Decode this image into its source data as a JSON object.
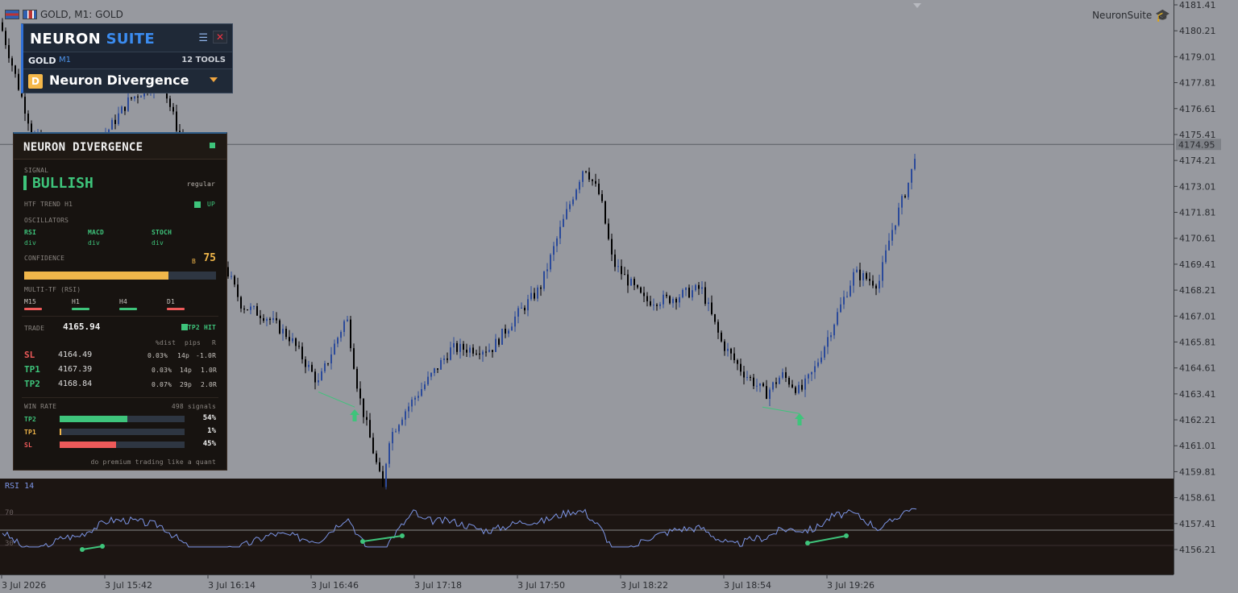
{
  "window": {
    "title": "GOLD, M1:  GOLD",
    "brand": "NeuronSuite"
  },
  "axis": {
    "price_labels": [
      "4181.41",
      "4180.21",
      "4179.01",
      "4177.81",
      "4176.61",
      "4175.41",
      "4174.21",
      "4173.01",
      "4171.81",
      "4170.61",
      "4169.41",
      "4168.21",
      "4167.01",
      "4165.81",
      "4164.61",
      "4163.41",
      "4162.21",
      "4161.01",
      "4159.81",
      "4158.61",
      "4157.41",
      "4156.21"
    ],
    "current_price": "4174.95",
    "time_labels": [
      "3 Jul 2026",
      "3 Jul 15:42",
      "3 Jul 16:14",
      "3 Jul 16:46",
      "3 Jul 17:18",
      "3 Jul 17:50",
      "3 Jul 18:22",
      "3 Jul 18:54",
      "3 Jul 19:26"
    ]
  },
  "rsi": {
    "title": "RSI 14",
    "level_high": "70",
    "level_low": "30"
  },
  "suite": {
    "title_a": "NEURON",
    "title_b": "SUITE",
    "symbol": "GOLD",
    "timeframe": "M1",
    "tools_count": "12 TOOLS",
    "tool_badge": "D",
    "tool_name": "Neuron Divergence"
  },
  "panel": {
    "title": "NEURON DIVERGENCE",
    "signal_label": "SIGNAL",
    "signal": "BULLISH",
    "signal_type": "regular",
    "htf_label": "HTF TREND H1",
    "htf_value": "UP",
    "osc_label": "OSCILLATORS",
    "oscillators": [
      {
        "name": "RSI",
        "state": "div"
      },
      {
        "name": "MACD",
        "state": "div"
      },
      {
        "name": "STOCH",
        "state": "div"
      }
    ],
    "confidence_label": "CONFIDENCE",
    "confidence_grade": "B",
    "confidence_value": "75",
    "confidence_fraction": 0.75,
    "mtf_label": "MULTI-TF (RSI)",
    "mtf": [
      {
        "tf": "M15",
        "color": "#ee5a5a"
      },
      {
        "tf": "H1",
        "color": "#3ec47b"
      },
      {
        "tf": "H4",
        "color": "#3ec47b"
      },
      {
        "tf": "D1",
        "color": "#ee5a5a"
      }
    ],
    "trade_label": "TRADE",
    "trade_price": "4165.94",
    "trade_status": "TP2 HIT",
    "col_dist": "%dist",
    "col_pips": "pips",
    "col_r": "R",
    "levels": [
      {
        "name": "SL",
        "price": "4164.49",
        "dist": "0.03%",
        "pips": "14p",
        "r": "-1.0R",
        "color": "#ee5a5a"
      },
      {
        "name": "TP1",
        "price": "4167.39",
        "dist": "0.03%",
        "pips": "14p",
        "r": "1.0R",
        "color": "#3ec47b"
      },
      {
        "name": "TP2",
        "price": "4168.84",
        "dist": "0.07%",
        "pips": "29p",
        "r": "2.0R",
        "color": "#3ec47b"
      }
    ],
    "winrate_label": "WIN RATE",
    "signals_count": "498 signals",
    "winrates": [
      {
        "name": "TP2",
        "pct": "54%",
        "fraction": 0.54,
        "color": "#3ec47b"
      },
      {
        "name": "TP1",
        "pct": "1%",
        "fraction": 0.01,
        "color": "#f0b64a"
      },
      {
        "name": "SL",
        "pct": "45%",
        "fraction": 0.45,
        "color": "#ee5a5a"
      }
    ],
    "footer": "do premium trading like a quant"
  },
  "colors": {
    "bull": "#3ec47b",
    "bear": "#ee5a5a",
    "accent": "#2f6fd6",
    "candle_up": "#2b4a9a",
    "candle_down": "#000000",
    "rsi_line": "#7c95e6"
  }
}
